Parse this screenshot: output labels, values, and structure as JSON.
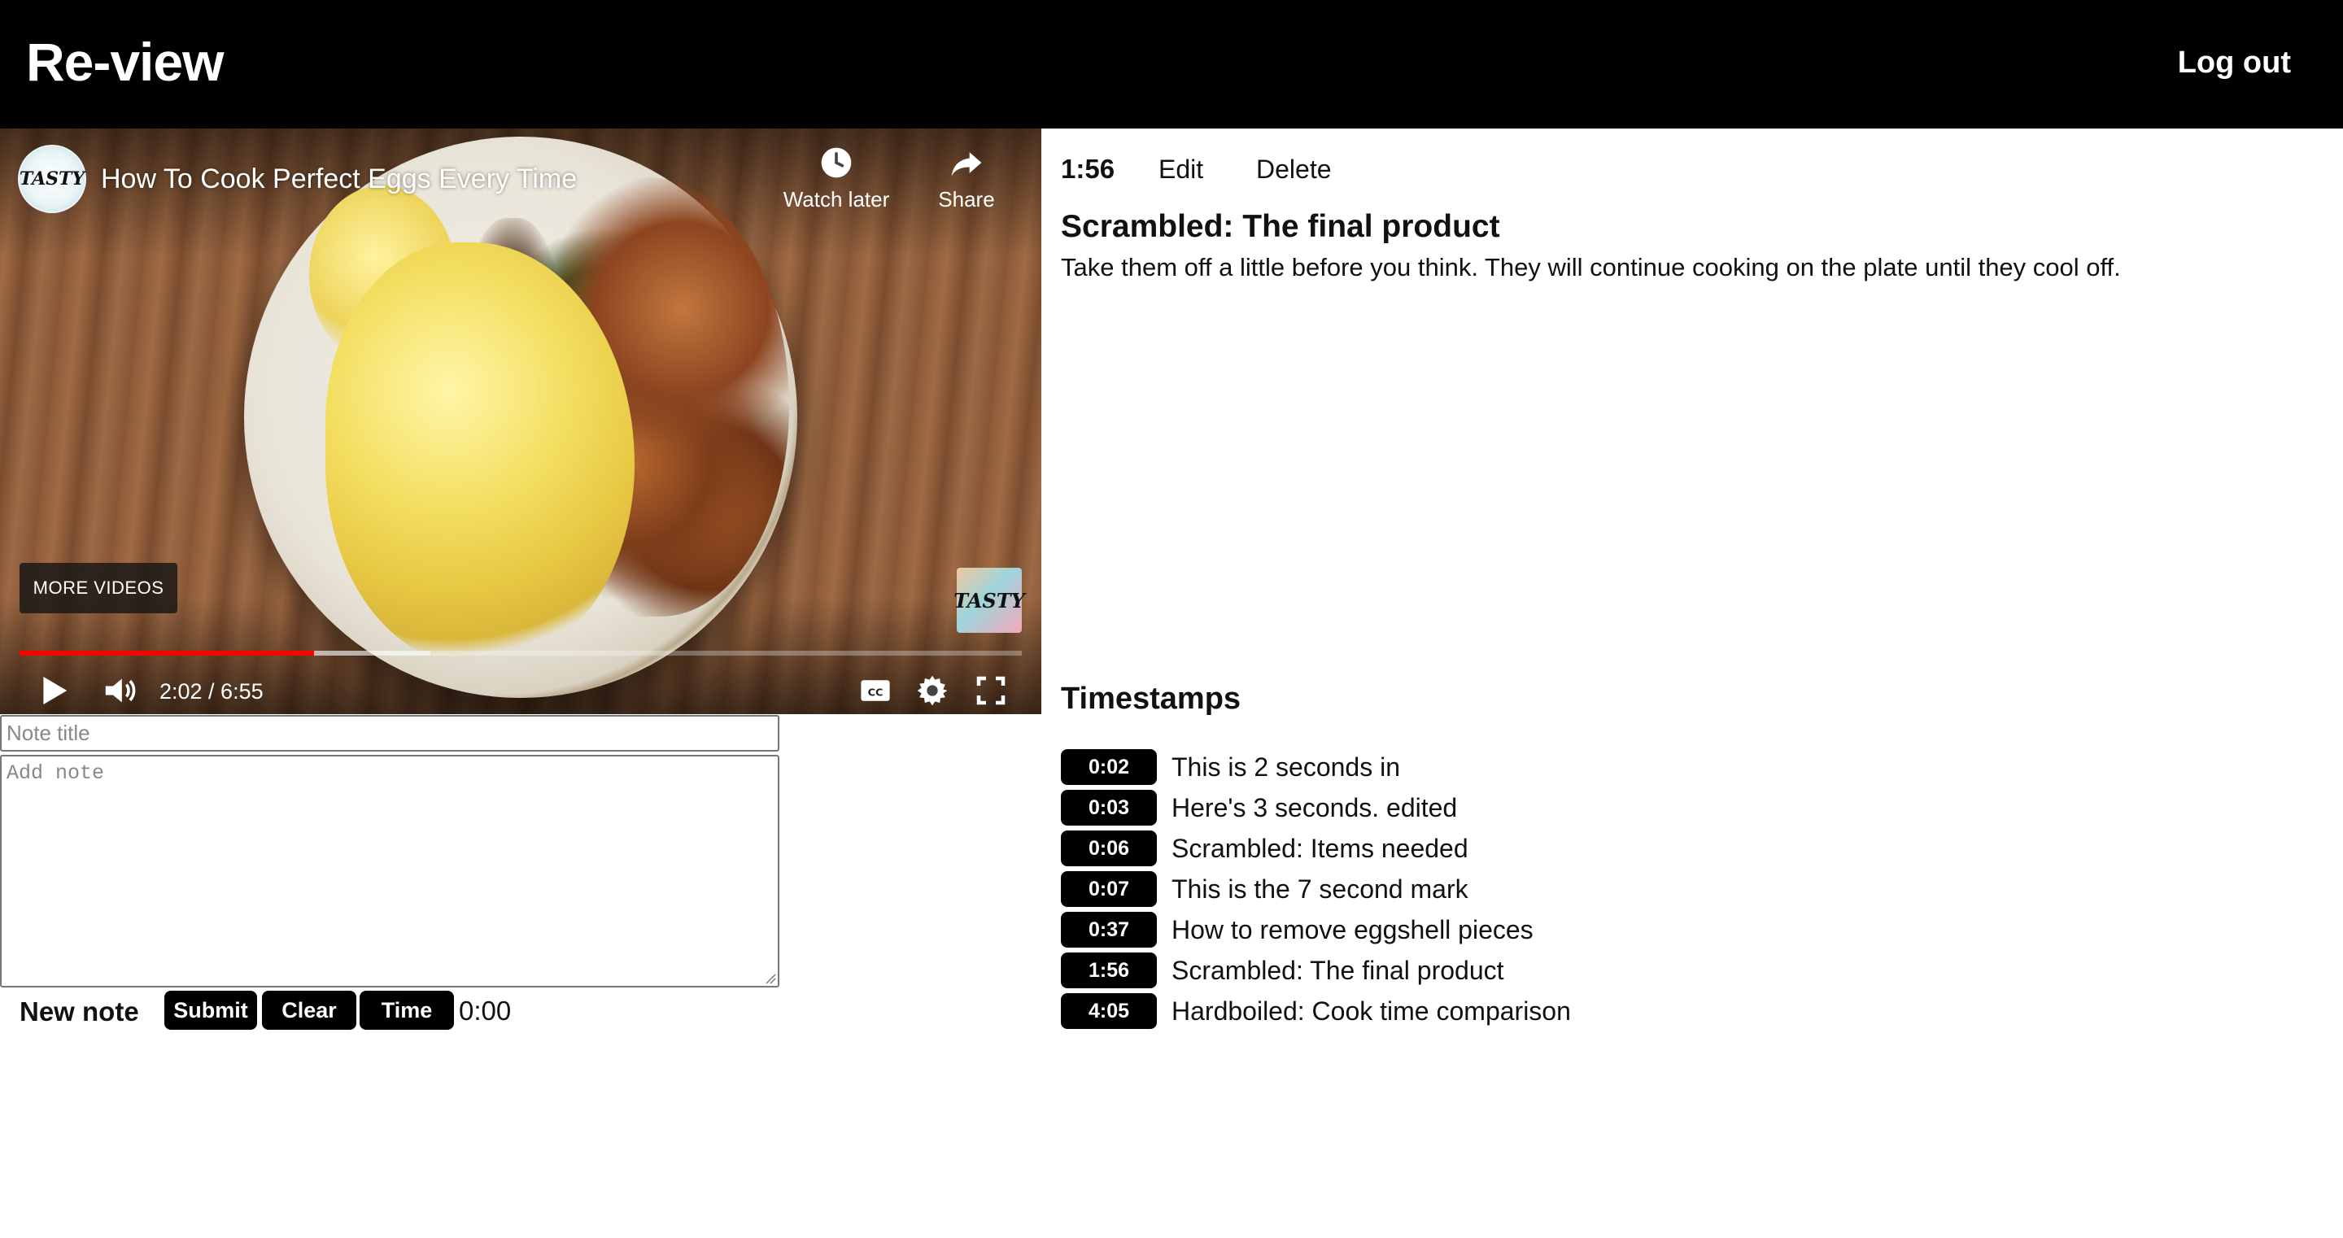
{
  "header": {
    "brand": "Re-view",
    "logout": "Log out"
  },
  "video": {
    "channel_avatar_text": "TASTY",
    "title": "How To Cook Perfect Eggs Every Time",
    "watch_later": "Watch later",
    "share": "Share",
    "more_videos": "MORE VIDEOS",
    "badge_text": "TASTY",
    "time_display": "2:02 / 6:55",
    "progress_fraction": 0.294,
    "buffered_fraction": 0.41,
    "progress_color": "#ff0000"
  },
  "form": {
    "title_placeholder": "Note title",
    "note_placeholder": "Add note",
    "new_note_label": "New note",
    "submit": "Submit",
    "clear": "Clear",
    "time": "Time",
    "time_value": "0:00"
  },
  "selected_note": {
    "time": "1:56",
    "edit": "Edit",
    "delete": "Delete",
    "title": "Scrambled: The final product",
    "body": "Take them off a little before you think. They will continue cooking on the plate until they cool off."
  },
  "timestamps": {
    "heading": "Timestamps",
    "items": [
      {
        "time": "0:02",
        "label": "This is 2 seconds in"
      },
      {
        "time": "0:03",
        "label": "Here's 3 seconds. edited"
      },
      {
        "time": "0:06",
        "label": "Scrambled: Items needed"
      },
      {
        "time": "0:07",
        "label": "This is the 7 second mark"
      },
      {
        "time": "0:37",
        "label": "How to remove eggshell pieces"
      },
      {
        "time": "1:56",
        "label": "Scrambled: The final product"
      },
      {
        "time": "4:05",
        "label": "Hardboiled: Cook time comparison"
      }
    ]
  }
}
